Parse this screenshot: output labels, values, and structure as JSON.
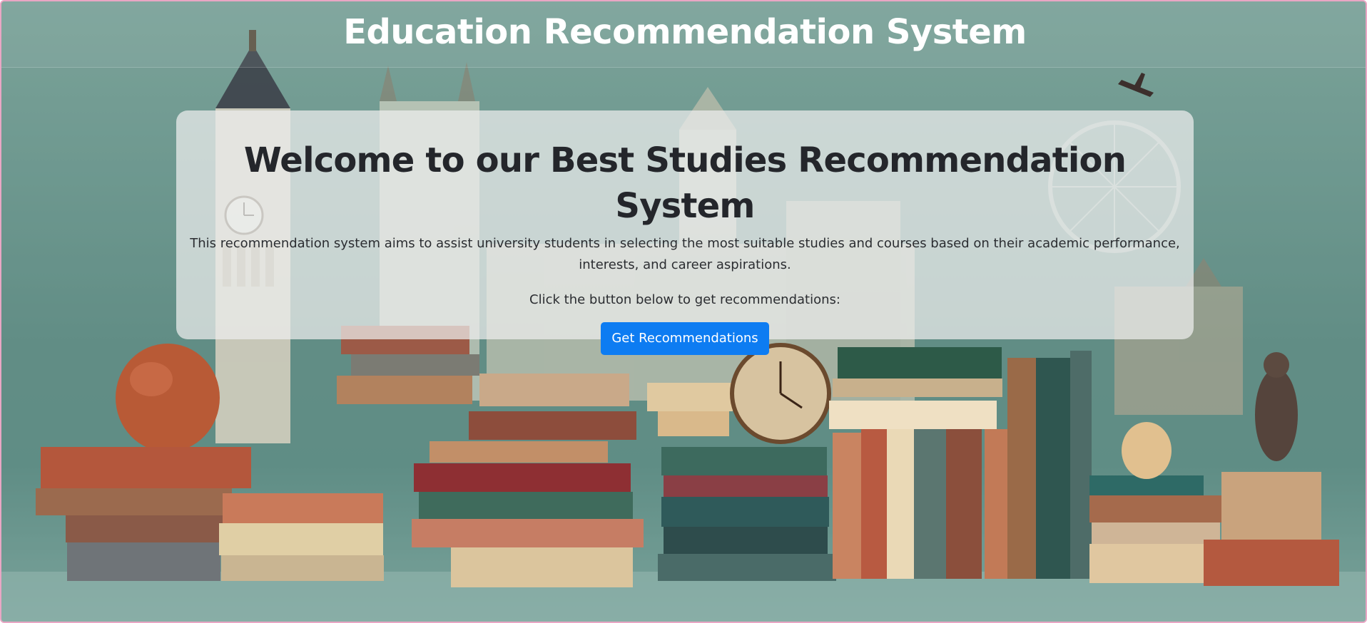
{
  "header": {
    "title": "Education Recommendation System"
  },
  "hero": {
    "heading": "Welcome to our Best Studies Recommendation System",
    "description": "This recommendation system aims to assist university students in selecting the most suitable studies and courses based on their academic performance, interests, and career aspirations.",
    "cta_text": "Click the button below to get recommendations:",
    "button_label": "Get Recommendations"
  },
  "colors": {
    "accent": "#0d7cf2",
    "title_text": "#ffffff",
    "heading_text": "#24262b",
    "card_background": "#eeeeee"
  },
  "background": {
    "image_subject": "books-and-london-landmarks"
  }
}
